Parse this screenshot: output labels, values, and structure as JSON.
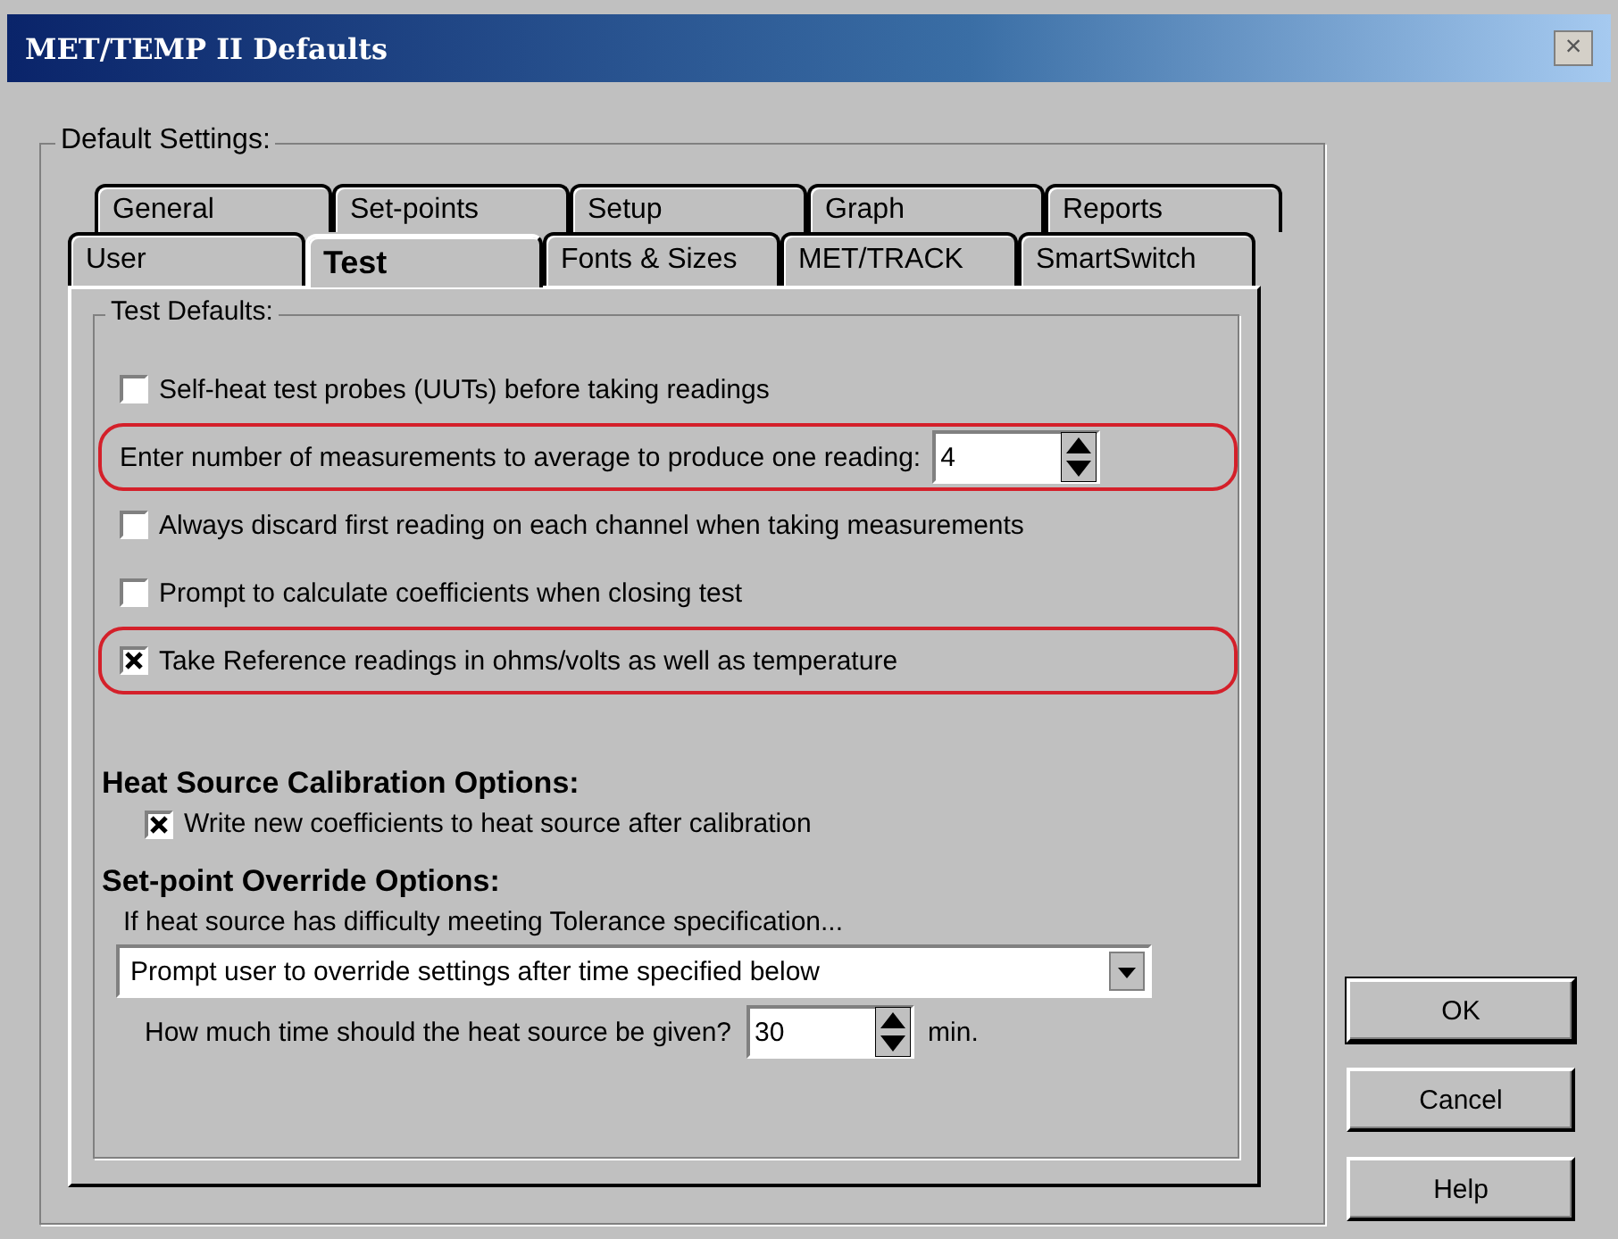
{
  "window": {
    "title": "MET/TEMP II Defaults",
    "close": "×"
  },
  "group_title": "Default Settings:",
  "tab_rows": [
    [
      {
        "label": "General",
        "selected": false
      },
      {
        "label": "Set-points",
        "selected": false
      },
      {
        "label": "Setup",
        "selected": false
      },
      {
        "label": "Graph",
        "selected": false
      },
      {
        "label": "Reports",
        "selected": false
      }
    ],
    [
      {
        "label": "User",
        "selected": false
      },
      {
        "label": "Test",
        "selected": true
      },
      {
        "label": "Fonts & Sizes",
        "selected": false
      },
      {
        "label": "MET/TRACK",
        "selected": false
      },
      {
        "label": "SmartSwitch",
        "selected": false
      }
    ]
  ],
  "test_defaults": {
    "title": "Test Defaults:",
    "options": [
      {
        "kind": "checkbox",
        "label": "Self-heat test probes (UUTs) before taking readings",
        "checked": false,
        "highlighted": false
      },
      {
        "kind": "spinner",
        "label": "Enter number of measurements to average to produce one reading:",
        "value": "4",
        "highlighted": true
      },
      {
        "kind": "checkbox",
        "label": "Always discard first reading on each channel when taking measurements",
        "checked": false,
        "highlighted": false
      },
      {
        "kind": "checkbox",
        "label": "Prompt to calculate coefficients when closing test",
        "checked": false,
        "highlighted": false
      },
      {
        "kind": "checkbox",
        "label": "Take Reference readings in ohms/volts as well as temperature",
        "checked": true,
        "highlighted": true
      }
    ]
  },
  "heat_source": {
    "title": "Heat Source Calibration Options:",
    "option": {
      "label": "Write new coefficients to heat source after calibration",
      "checked": true
    }
  },
  "override": {
    "title": "Set-point Override Options:",
    "prompt": "If heat source has difficulty meeting Tolerance specification...",
    "dropdown": "Prompt user to override settings after time specified below",
    "time_label": "How much time should the heat source be given?",
    "time_value": "30",
    "unit": "min."
  },
  "buttons": [
    "OK",
    "Cancel",
    "Help"
  ]
}
